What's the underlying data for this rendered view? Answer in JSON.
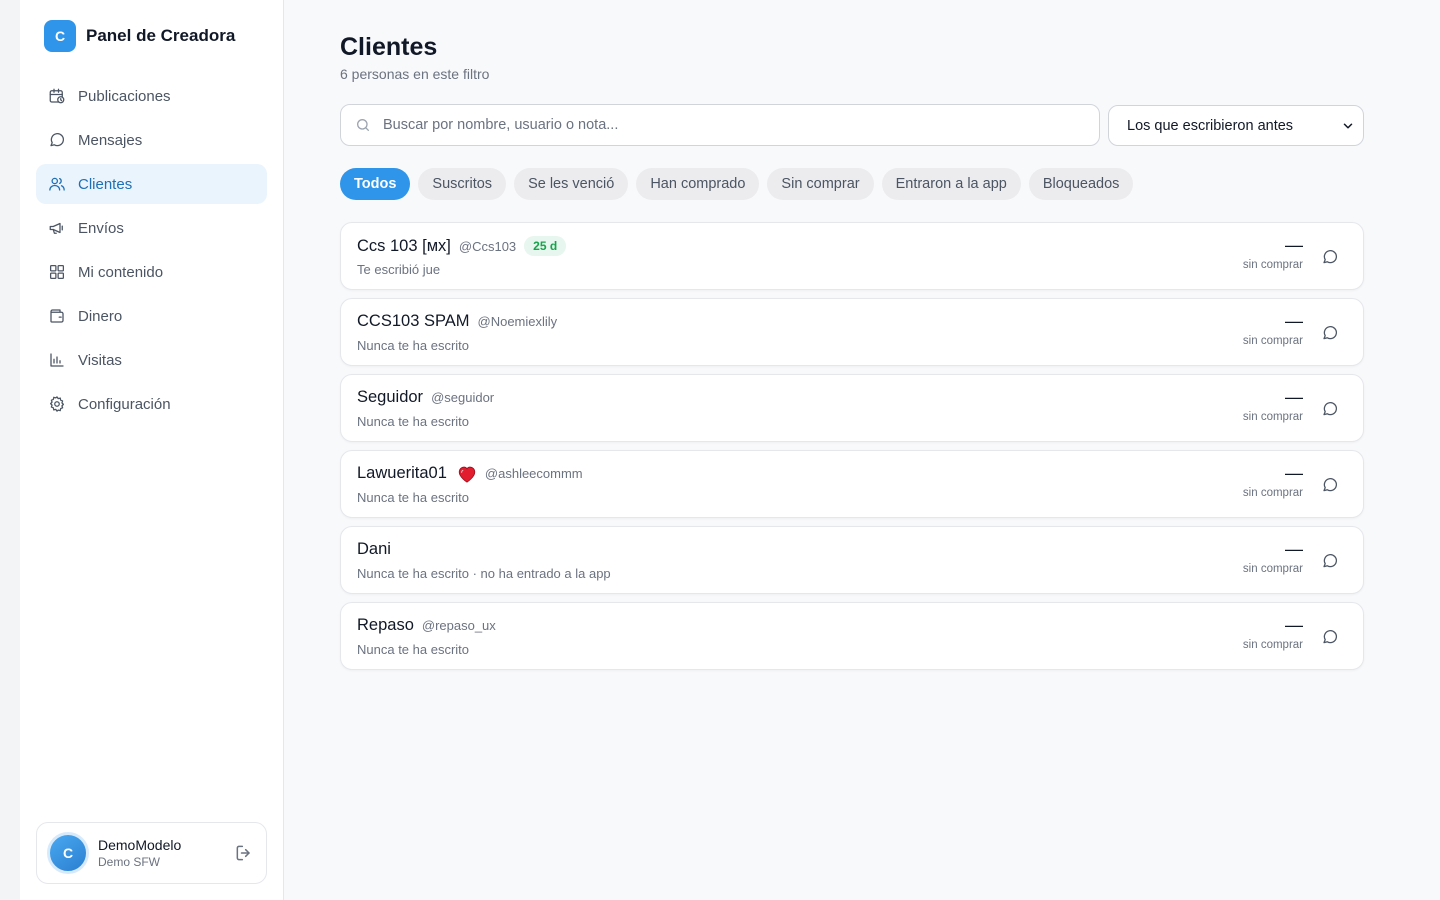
{
  "brand": {
    "initial": "C",
    "name": "Panel de Creadora"
  },
  "nav": [
    {
      "label": "Publicaciones",
      "icon": "calendar-clock-icon",
      "active": false
    },
    {
      "label": "Mensajes",
      "icon": "message-icon",
      "active": false
    },
    {
      "label": "Clientes",
      "icon": "users-icon",
      "active": true
    },
    {
      "label": "Envíos",
      "icon": "megaphone-icon",
      "active": false
    },
    {
      "label": "Mi contenido",
      "icon": "grid-icon",
      "active": false
    },
    {
      "label": "Dinero",
      "icon": "wallet-icon",
      "active": false
    },
    {
      "label": "Visitas",
      "icon": "bar-chart-icon",
      "active": false
    },
    {
      "label": "Configuración",
      "icon": "gear-icon",
      "active": false
    }
  ],
  "user": {
    "initial": "C",
    "name": "DemoModelo",
    "subtitle": "Demo SFW"
  },
  "page": {
    "title": "Clientes",
    "subtitle": "6 personas en este filtro"
  },
  "search": {
    "placeholder": "Buscar por nombre, usuario o nota...",
    "value": ""
  },
  "sort": {
    "selected": "Los que escribieron antes"
  },
  "filters": [
    {
      "label": "Todos",
      "active": true
    },
    {
      "label": "Suscritos",
      "active": false
    },
    {
      "label": "Se les venció",
      "active": false
    },
    {
      "label": "Han comprado",
      "active": false
    },
    {
      "label": "Sin comprar",
      "active": false
    },
    {
      "label": "Entraron a la app",
      "active": false
    },
    {
      "label": "Bloqueados",
      "active": false
    }
  ],
  "clients": [
    {
      "name": "Ccs 103 [ᴍx]",
      "handle": "@Ccs103",
      "badge": "25 d",
      "heart": false,
      "note": "Te escribió jue",
      "amount": "—",
      "status": "sin comprar"
    },
    {
      "name": "CCS103 SPAM",
      "handle": "@Noemiexlily",
      "badge": "",
      "heart": false,
      "note": "Nunca te ha escrito",
      "amount": "—",
      "status": "sin comprar"
    },
    {
      "name": "Seguidor",
      "handle": "@seguidor",
      "badge": "",
      "heart": false,
      "note": "Nunca te ha escrito",
      "amount": "—",
      "status": "sin comprar"
    },
    {
      "name": "Lawuerita01",
      "handle": "@ashleecommm",
      "badge": "",
      "heart": true,
      "note": "Nunca te ha escrito",
      "amount": "—",
      "status": "sin comprar"
    },
    {
      "name": "Dani",
      "handle": "",
      "badge": "",
      "heart": false,
      "note": "Nunca te ha escrito · no ha entrado a la app",
      "amount": "—",
      "status": "sin comprar"
    },
    {
      "name": "Repaso",
      "handle": "@repaso_ux",
      "badge": "",
      "heart": false,
      "note": "Nunca te ha escrito",
      "amount": "—",
      "status": "sin comprar"
    }
  ],
  "colors": {
    "accent": "#2f95ea",
    "active_nav_bg": "#eaf4fd",
    "active_nav_text": "#1f6fb5",
    "badge_green": "#16a34a",
    "heart_red": "#e11d2e"
  }
}
